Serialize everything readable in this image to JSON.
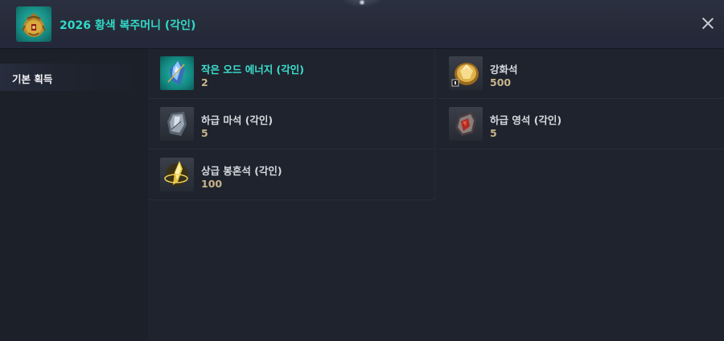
{
  "header": {
    "title": "2026 황색 복주머니 (각인)",
    "icon": "pouch-icon"
  },
  "sidebar": {
    "items": [
      {
        "label": "기본 획득"
      }
    ]
  },
  "rewards": [
    {
      "name": "작은 오드 에너지 (각인)",
      "qty": "2",
      "icon": "blue-crystal-icon",
      "highlighted": true
    },
    {
      "name": "강화석",
      "qty": "500",
      "icon": "gold-stone-icon",
      "highlighted": false
    },
    {
      "name": "하급 마석 (각인)",
      "qty": "5",
      "icon": "silver-stone-icon",
      "highlighted": false
    },
    {
      "name": "하급 영석 (각인)",
      "qty": "5",
      "icon": "red-stone-icon",
      "highlighted": false
    },
    {
      "name": "상급 봉혼석 (각인)",
      "qty": "100",
      "icon": "golden-crystal-icon",
      "highlighted": false
    }
  ],
  "colors": {
    "accent": "#31d9c8",
    "quantity": "#c8b48c",
    "background": "#1f232d"
  }
}
